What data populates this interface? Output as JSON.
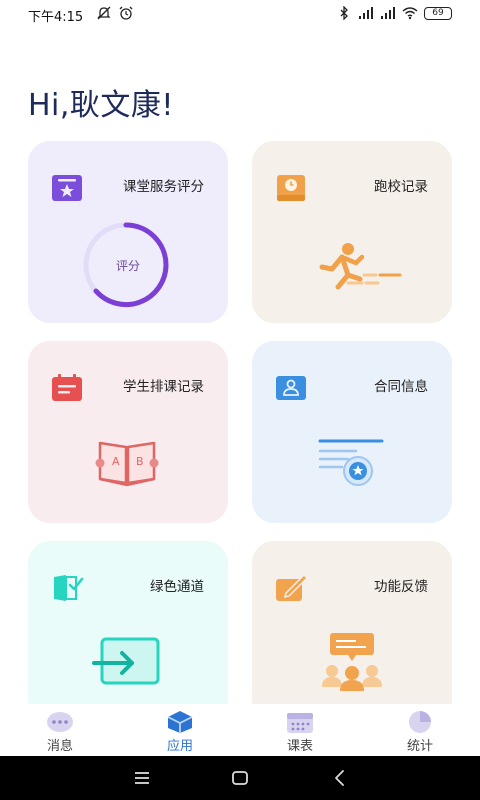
{
  "status_bar": {
    "time": "下午4:15",
    "battery": "69",
    "left_icons": [
      "no-notification-icon",
      "alarm-icon"
    ],
    "right_icons": [
      "bluetooth-icon",
      "signal-hd-icon",
      "signal-hd-icon",
      "wifi-icon"
    ]
  },
  "greeting": "Hi,耿文康!",
  "cards": [
    {
      "title": "课堂服务评分",
      "icon": "star-card-icon",
      "color": "#7b4ddb",
      "gauge_label": "评分",
      "gauge_progress": 0.6
    },
    {
      "title": "跑校记录",
      "icon": "clock-book-icon",
      "color": "#f0a14a"
    },
    {
      "title": "学生排课记录",
      "icon": "calendar-icon",
      "color": "#e65050",
      "book_letters": [
        "A",
        "B"
      ]
    },
    {
      "title": "合同信息",
      "icon": "id-card-icon",
      "color": "#3b8fe0"
    },
    {
      "title": "绿色通道",
      "icon": "green-channel-icon",
      "color": "#25d5c0"
    },
    {
      "title": "功能反馈",
      "icon": "feedback-icon",
      "color": "#f2a34e"
    }
  ],
  "tabs": [
    {
      "label": "消息",
      "icon": "message-icon",
      "active": false
    },
    {
      "label": "应用",
      "icon": "app-cube-icon",
      "active": true
    },
    {
      "label": "课表",
      "icon": "schedule-icon",
      "active": false
    },
    {
      "label": "统计",
      "icon": "pie-chart-icon",
      "active": false
    }
  ],
  "colors": {
    "accent": "#2c74d3",
    "greeting": "#1e2a5a"
  }
}
